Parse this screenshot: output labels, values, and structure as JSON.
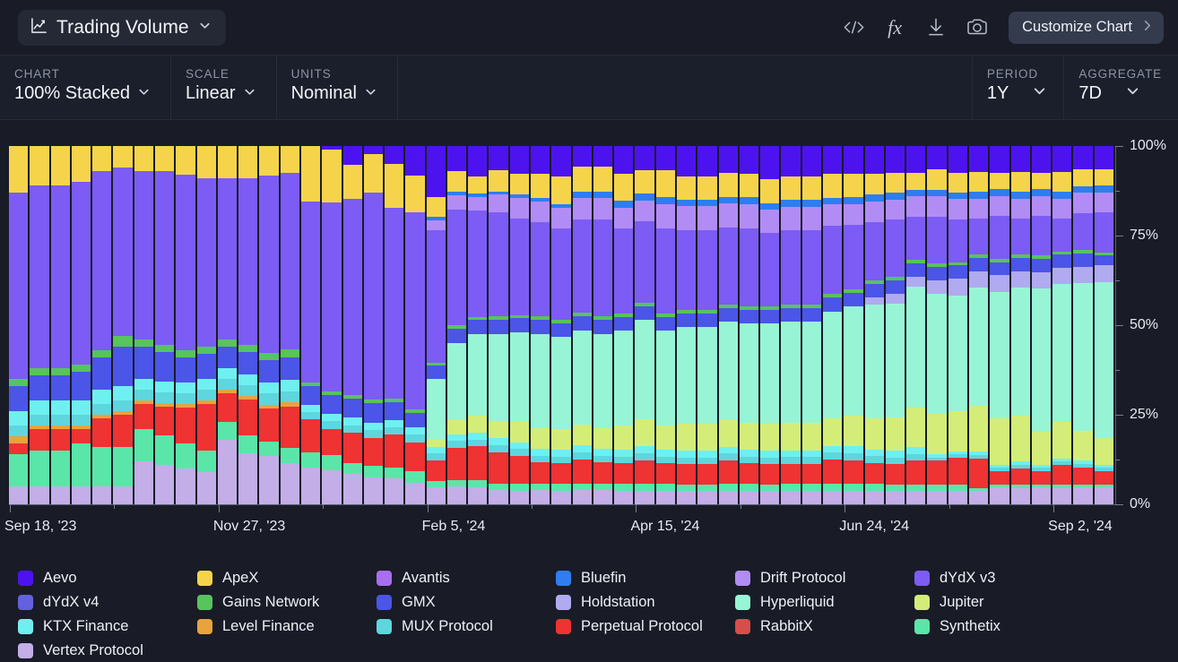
{
  "header": {
    "title": "Trading Volume",
    "title_icon": "line-chart-icon",
    "dropdown_icon": "chevron-down-icon",
    "actions": [
      {
        "name": "embed-code-button",
        "glyph": "</>",
        "label": "Embed code"
      },
      {
        "name": "formula-button",
        "glyph": "fx",
        "label": "Formula"
      },
      {
        "name": "download-button",
        "glyph": "download-icon",
        "label": "Download"
      },
      {
        "name": "screenshot-button",
        "glyph": "camera-icon",
        "label": "Screenshot"
      }
    ],
    "customize_label": "Customize Chart",
    "customize_chevron": "chevron-right-icon"
  },
  "controls": [
    {
      "name": "chart-type",
      "label": "CHART",
      "value": "100% Stacked"
    },
    {
      "name": "scale",
      "label": "SCALE",
      "value": "Linear"
    },
    {
      "name": "units",
      "label": "UNITS",
      "value": "Nominal"
    }
  ],
  "controls_right": [
    {
      "name": "period",
      "label": "PERIOD",
      "value": "1Y"
    },
    {
      "name": "aggregate",
      "label": "AGGREGATE",
      "value": "7D"
    }
  ],
  "legend": [
    {
      "label": "Aevo",
      "color": "#4d13ee"
    },
    {
      "label": "ApeX",
      "color": "#f5d44c"
    },
    {
      "label": "Avantis",
      "color": "#a96ef0"
    },
    {
      "label": "Bluefin",
      "color": "#2f7df0"
    },
    {
      "label": "Drift Protocol",
      "color": "#b28cf5"
    },
    {
      "label": "dYdX v3",
      "color": "#7c5cf5"
    },
    {
      "label": "dYdX v4",
      "color": "#6461e0"
    },
    {
      "label": "Gains Network",
      "color": "#57c45c"
    },
    {
      "label": "GMX",
      "color": "#4b55e8"
    },
    {
      "label": "Holdstation",
      "color": "#b0aaf0"
    },
    {
      "label": "Hyperliquid",
      "color": "#97f5d5"
    },
    {
      "label": "Jupiter",
      "color": "#d4ed78"
    },
    {
      "label": "KTX Finance",
      "color": "#6ef0f0"
    },
    {
      "label": "Level Finance",
      "color": "#e8a33d"
    },
    {
      "label": "MUX Protocol",
      "color": "#5ed6dd"
    },
    {
      "label": "Perpetual Protocol",
      "color": "#ef3232"
    },
    {
      "label": "RabbitX",
      "color": "#d94c4c"
    },
    {
      "label": "Synthetix",
      "color": "#5ae6a8"
    },
    {
      "label": "Vertex Protocol",
      "color": "#c3aee8"
    }
  ],
  "chart_data": {
    "type": "bar",
    "stacked": "100%",
    "title": "Trading Volume",
    "xlabel": "",
    "ylabel": "",
    "ylim": [
      0,
      100
    ],
    "ytick_labels": [
      "0%",
      "25%",
      "50%",
      "75%",
      "100%"
    ],
    "ytick_values": [
      0,
      25,
      50,
      75,
      100
    ],
    "yminor_values": [
      12.5,
      37.5,
      62.5,
      87.5
    ],
    "grid": false,
    "legend_position": "bottom",
    "xtick_labels": [
      "Sep 18, '23",
      "Nov 27, '23",
      "Feb 5, '24",
      "Apr 15, '24",
      "Jun 24, '24",
      "Sep 2, '24"
    ],
    "xtick_indices": [
      0,
      10,
      20,
      30,
      40,
      50
    ],
    "bar_count": 53,
    "stack_order": [
      "Vertex Protocol",
      "Synthetix",
      "RabbitX",
      "Perpetual Protocol",
      "Level Finance",
      "MUX Protocol",
      "KTX Finance",
      "Jupiter",
      "Hyperliquid",
      "Holdstation",
      "GMX",
      "Gains Network",
      "dYdX v4",
      "dYdX v3",
      "Drift Protocol",
      "Bluefin",
      "Avantis",
      "ApeX",
      "Aevo"
    ],
    "series": [
      {
        "name": "Vertex Protocol",
        "color": "#c3aee8",
        "values": [
          5,
          5,
          5,
          5,
          5,
          5,
          12,
          11,
          10,
          9,
          18,
          14,
          13,
          11,
          10,
          9,
          8,
          7,
          7,
          6,
          5,
          5,
          5,
          4,
          4,
          4,
          4,
          4,
          4,
          4,
          4,
          4,
          4,
          4,
          4,
          4,
          4,
          4,
          4,
          4,
          4,
          4,
          4,
          4,
          4,
          4,
          4,
          5,
          5,
          5,
          5,
          5,
          5
        ]
      },
      {
        "name": "Synthetix",
        "color": "#5ae6a8",
        "values": [
          9,
          10,
          10,
          12,
          11,
          11,
          9,
          8,
          7,
          6,
          5,
          5,
          4,
          4,
          4,
          4,
          3,
          3,
          3,
          3,
          2,
          2,
          2,
          2,
          2,
          2,
          2,
          2,
          2,
          2,
          2,
          2,
          2,
          2,
          2,
          2,
          2,
          2,
          2,
          2,
          2,
          2,
          2,
          2,
          2,
          2,
          1,
          1,
          1,
          1,
          1,
          1,
          1
        ]
      },
      {
        "name": "RabbitX",
        "color": "#d94c4c",
        "values": [
          0,
          0,
          0,
          0,
          0,
          0,
          0,
          0,
          0,
          0,
          0,
          0,
          0,
          0,
          0,
          0,
          0,
          0,
          0,
          0,
          0,
          0,
          0,
          0,
          0,
          0,
          0,
          0,
          0,
          0,
          0,
          0,
          0,
          0,
          0,
          0,
          0,
          0,
          0,
          0,
          0,
          0,
          0,
          0,
          0,
          0,
          0,
          0,
          0,
          0,
          0,
          0,
          0
        ]
      },
      {
        "name": "Perpetual Protocol",
        "color": "#ef3232",
        "values": [
          3,
          6,
          6,
          4,
          8,
          9,
          7,
          8,
          10,
          13,
          8,
          10,
          9,
          11,
          9,
          7,
          8,
          7,
          9,
          8,
          6,
          9,
          10,
          9,
          8,
          6,
          6,
          7,
          6,
          6,
          7,
          6,
          6,
          6,
          7,
          6,
          6,
          6,
          6,
          7,
          7,
          6,
          6,
          7,
          7,
          8,
          9,
          4,
          5,
          4,
          6,
          5,
          4
        ]
      },
      {
        "name": "Level Finance",
        "color": "#e8a33d",
        "values": [
          2,
          1,
          1,
          1,
          1,
          1,
          1,
          1,
          1,
          1,
          1,
          1,
          1,
          1,
          0,
          0,
          0,
          0,
          0,
          0,
          0,
          0,
          0,
          0,
          0,
          0,
          0,
          0,
          0,
          0,
          0,
          0,
          0,
          0,
          0,
          0,
          0,
          0,
          0,
          0,
          0,
          0,
          0,
          0,
          0,
          0,
          0,
          0,
          0,
          0,
          0,
          0,
          0
        ]
      },
      {
        "name": "MUX Protocol",
        "color": "#5ed6dd",
        "values": [
          3,
          3,
          3,
          3,
          3,
          3,
          3,
          3,
          3,
          3,
          3,
          3,
          3,
          3,
          2,
          2,
          2,
          2,
          2,
          2,
          2,
          2,
          2,
          2,
          2,
          2,
          2,
          2,
          2,
          2,
          2,
          2,
          2,
          2,
          2,
          2,
          2,
          2,
          2,
          2,
          2,
          2,
          2,
          2,
          1,
          1,
          1,
          1,
          1,
          1,
          1,
          1,
          1
        ]
      },
      {
        "name": "KTX Finance",
        "color": "#6ef0f0",
        "values": [
          4,
          4,
          4,
          4,
          4,
          4,
          3,
          3,
          3,
          3,
          3,
          3,
          3,
          3,
          2,
          2,
          2,
          2,
          2,
          2,
          2,
          2,
          2,
          2,
          2,
          2,
          2,
          2,
          2,
          2,
          2,
          2,
          2,
          2,
          2,
          2,
          2,
          2,
          2,
          2,
          2,
          2,
          2,
          2,
          1,
          1,
          1,
          1,
          1,
          1,
          1,
          1,
          1
        ]
      },
      {
        "name": "Jupiter",
        "color": "#d4ed78",
        "values": [
          0,
          0,
          0,
          0,
          0,
          0,
          0,
          0,
          0,
          0,
          0,
          0,
          0,
          0,
          0,
          0,
          0,
          0,
          0,
          0,
          2,
          4,
          5,
          5,
          6,
          6,
          6,
          6,
          6,
          7,
          8,
          7,
          8,
          8,
          8,
          8,
          8,
          8,
          8,
          8,
          9,
          9,
          10,
          12,
          12,
          12,
          14,
          14,
          14,
          10,
          11,
          9,
          8
        ]
      },
      {
        "name": "Hyperliquid",
        "color": "#97f5d5",
        "values": [
          0,
          0,
          0,
          0,
          0,
          0,
          0,
          0,
          0,
          0,
          0,
          0,
          0,
          0,
          0,
          0,
          0,
          0,
          0,
          0,
          18,
          22,
          24,
          25,
          26,
          27,
          27,
          27,
          27,
          28,
          29,
          28,
          29,
          29,
          29,
          29,
          30,
          30,
          30,
          31,
          32,
          33,
          34,
          36,
          36,
          35,
          36,
          38,
          39,
          43,
          42,
          44,
          47
        ]
      },
      {
        "name": "Holdstation",
        "color": "#b0aaf0",
        "values": [
          0,
          0,
          0,
          0,
          0,
          0,
          0,
          0,
          0,
          0,
          0,
          0,
          0,
          0,
          0,
          0,
          0,
          0,
          0,
          0,
          0,
          0,
          0,
          0,
          0,
          0,
          0,
          0,
          0,
          0,
          0,
          0,
          0,
          0,
          0,
          0,
          0,
          0,
          0,
          0,
          0,
          2,
          3,
          3,
          4,
          5,
          5,
          5,
          5,
          5,
          5,
          5,
          5
        ]
      },
      {
        "name": "GMX",
        "color": "#4b55e8",
        "values": [
          7,
          7,
          7,
          8,
          9,
          11,
          9,
          8,
          7,
          7,
          6,
          6,
          6,
          6,
          5,
          5,
          5,
          5,
          5,
          4,
          4,
          4,
          4,
          4,
          4,
          4,
          4,
          4,
          4,
          4,
          4,
          4,
          4,
          4,
          4,
          4,
          4,
          4,
          4,
          4,
          4,
          4,
          4,
          4,
          4,
          4,
          4,
          4,
          4,
          4,
          4,
          4,
          3
        ]
      },
      {
        "name": "Gains Network",
        "color": "#57c45c",
        "values": [
          2,
          2,
          2,
          2,
          2,
          3,
          2,
          2,
          2,
          2,
          2,
          2,
          2,
          2,
          1,
          1,
          1,
          1,
          1,
          1,
          1,
          1,
          1,
          1,
          1,
          1,
          1,
          1,
          1,
          1,
          1,
          1,
          1,
          1,
          1,
          1,
          1,
          1,
          1,
          1,
          1,
          1,
          1,
          1,
          1,
          1,
          1,
          1,
          1,
          1,
          1,
          1,
          1
        ]
      },
      {
        "name": "dYdX v4",
        "color": "#6461e0",
        "values": [
          0,
          0,
          0,
          0,
          0,
          0,
          0,
          0,
          0,
          0,
          0,
          0,
          0,
          0,
          0,
          0,
          0,
          0,
          0,
          0,
          0,
          0,
          0,
          0,
          0,
          0,
          0,
          0,
          0,
          0,
          0,
          0,
          0,
          0,
          0,
          0,
          0,
          0,
          0,
          0,
          0,
          0,
          0,
          0,
          0,
          0,
          0,
          0,
          0,
          0,
          0,
          0,
          0
        ]
      },
      {
        "name": "dYdX v3",
        "color": "#7c5cf5",
        "values": [
          52,
          51,
          51,
          51,
          50,
          47,
          47,
          48,
          49,
          47,
          45,
          46,
          48,
          47,
          49,
          50,
          52,
          53,
          52,
          54,
          39,
          33,
          31,
          30,
          28,
          27,
          27,
          27,
          28,
          25,
          24,
          25,
          24,
          24,
          23,
          23,
          22,
          22,
          22,
          20,
          19,
          17,
          17,
          13,
          14,
          13,
          11,
          13,
          11,
          12,
          10,
          11,
          12
        ]
      },
      {
        "name": "Drift Protocol",
        "color": "#b28cf5",
        "values": [
          0,
          0,
          0,
          0,
          0,
          0,
          0,
          0,
          0,
          0,
          0,
          0,
          0,
          0,
          0,
          0,
          0,
          0,
          0,
          0,
          3,
          4,
          4,
          5,
          6,
          6,
          6,
          6,
          6,
          6,
          6,
          7,
          7,
          7,
          7,
          7,
          7,
          7,
          7,
          6,
          6,
          6,
          6,
          6,
          6,
          6,
          6,
          6,
          6,
          6,
          6,
          6,
          6
        ]
      },
      {
        "name": "Bluefin",
        "color": "#2f7df0",
        "values": [
          0,
          0,
          0,
          0,
          0,
          0,
          0,
          0,
          0,
          0,
          0,
          0,
          0,
          0,
          0,
          0,
          0,
          0,
          0,
          0,
          1,
          1,
          1,
          1,
          1,
          1,
          1,
          2,
          2,
          2,
          2,
          2,
          2,
          2,
          2,
          2,
          2,
          2,
          2,
          2,
          2,
          2,
          2,
          2,
          2,
          2,
          2,
          2,
          2,
          2,
          2,
          2,
          2
        ]
      },
      {
        "name": "Avantis",
        "color": "#a96ef0",
        "values": [
          0,
          0,
          0,
          0,
          0,
          0,
          0,
          0,
          0,
          0,
          0,
          0,
          0,
          0,
          0,
          0,
          0,
          0,
          0,
          0,
          0,
          0,
          0,
          0,
          0,
          0,
          0,
          0,
          0,
          0,
          0,
          0,
          0,
          0,
          0,
          0,
          0,
          0,
          0,
          0,
          0,
          0,
          0,
          0,
          0,
          0,
          0,
          0,
          0,
          0,
          0,
          0,
          0
        ]
      },
      {
        "name": "ApeX",
        "color": "#f5d44c",
        "values": [
          13,
          11,
          11,
          10,
          7,
          6,
          7,
          7,
          8,
          9,
          9,
          9,
          8,
          7,
          15,
          14,
          9,
          10,
          12,
          10,
          6,
          6,
          5,
          6,
          6,
          7,
          8,
          7,
          7,
          8,
          7,
          8,
          7,
          7,
          7,
          7,
          7,
          7,
          7,
          7,
          7,
          6,
          6,
          5,
          6,
          6,
          6,
          5,
          6,
          5,
          6,
          5,
          5
        ]
      },
      {
        "name": "Aevo",
        "color": "#4d13ee",
        "values": [
          0,
          0,
          0,
          0,
          0,
          0,
          0,
          0,
          0,
          0,
          0,
          0,
          0,
          0,
          0,
          1,
          5,
          2,
          5,
          8,
          15,
          7,
          9,
          7,
          8,
          8,
          9,
          6,
          6,
          8,
          7,
          7,
          9,
          9,
          8,
          8,
          10,
          9,
          9,
          8,
          8,
          8,
          8,
          8,
          7,
          8,
          8,
          8,
          8,
          8,
          8,
          7,
          7
        ]
      }
    ]
  }
}
